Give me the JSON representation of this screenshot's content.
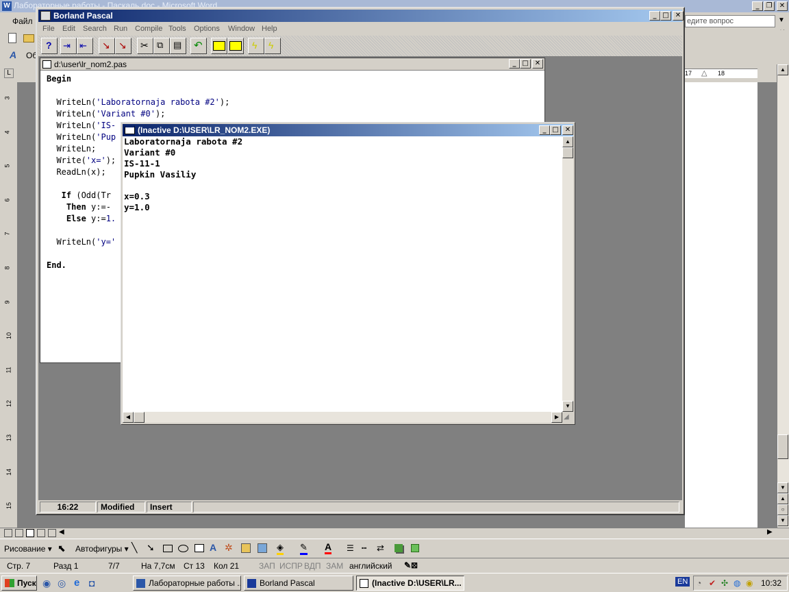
{
  "word": {
    "title": "Лабораторные работы - Паскаль.doc - Microsoft Word",
    "menu_file": "Файл",
    "ask_question": "едите вопрос",
    "style_prefix": "Об",
    "ruler_17": "17",
    "ruler_18": "18",
    "vruler_numbers": [
      "3",
      "4",
      "5",
      "6",
      "7",
      "8",
      "9",
      "10",
      "11",
      "12",
      "13",
      "14",
      "15"
    ],
    "draw_label": "Рисование",
    "autoshapes_label": "Автофигуры",
    "status": {
      "page": "Стр. 7",
      "section": "Разд 1",
      "pages": "7/7",
      "at": "На 7,7см",
      "line": "Ст 13",
      "col": "Кол 21",
      "rec": "ЗАП",
      "trk": "ИСПР",
      "ext": "ВДП",
      "ovr": "ЗАМ",
      "lang": "английский"
    }
  },
  "borland": {
    "title": "Borland Pascal",
    "menu": [
      "File",
      "Edit",
      "Search",
      "Run",
      "Compile",
      "Tools",
      "Options",
      "Window",
      "Help"
    ],
    "status": {
      "position": "16:22",
      "modified": "Modified",
      "insert": "Insert"
    }
  },
  "editor": {
    "title": "d:\\user\\lr_nom2.pas",
    "lines": [
      {
        "kw": "Begin",
        "rest": ""
      },
      {
        "kw": "",
        "rest": ""
      },
      {
        "kw": "",
        "rest": "  WriteLn(",
        "str": "'Laboratornaja rabota #2'",
        "tail": ");"
      },
      {
        "kw": "",
        "rest": "  WriteLn(",
        "str": "'Variant #0'",
        "tail": ");"
      },
      {
        "kw": "",
        "rest": "  WriteLn(",
        "str": "'IS-",
        "tail": ""
      },
      {
        "kw": "",
        "rest": "  WriteLn(",
        "str": "'Pup",
        "tail": ""
      },
      {
        "kw": "",
        "rest": "  WriteLn;",
        "str": "",
        "tail": ""
      },
      {
        "kw": "",
        "rest": "  Write(",
        "str": "'x='",
        "tail": ");"
      },
      {
        "kw": "",
        "rest": "  ReadLn(x);",
        "str": "",
        "tail": ""
      },
      {
        "kw": "",
        "rest": ""
      },
      {
        "kw": "   If",
        "rest": " (Odd(Tr",
        "str": "",
        "tail": ""
      },
      {
        "kw": "    Then",
        "rest": " y:=-",
        "str": "",
        "tail": ""
      },
      {
        "kw": "    Else",
        "rest": " y:=",
        "str": "1.",
        "tail": ""
      },
      {
        "kw": "",
        "rest": ""
      },
      {
        "kw": "",
        "rest": "  WriteLn(",
        "str": "'y='",
        "tail": ""
      },
      {
        "kw": "",
        "rest": ""
      },
      {
        "kw": "End.",
        "rest": ""
      }
    ]
  },
  "console": {
    "title": "(Inactive D:\\USER\\LR_NOM2.EXE)",
    "lines": [
      "Laboratornaja rabota #2",
      "Variant #0",
      "IS-11-1",
      "Pupkin Vasiliy",
      "",
      "x=0.3",
      "y=1.0"
    ]
  },
  "taskbar": {
    "start": "Пуск",
    "items": [
      "Лабораторные работы ...",
      "Borland Pascal",
      "(Inactive D:\\USER\\LR..."
    ],
    "lang": "EN",
    "clock": "10:32"
  }
}
